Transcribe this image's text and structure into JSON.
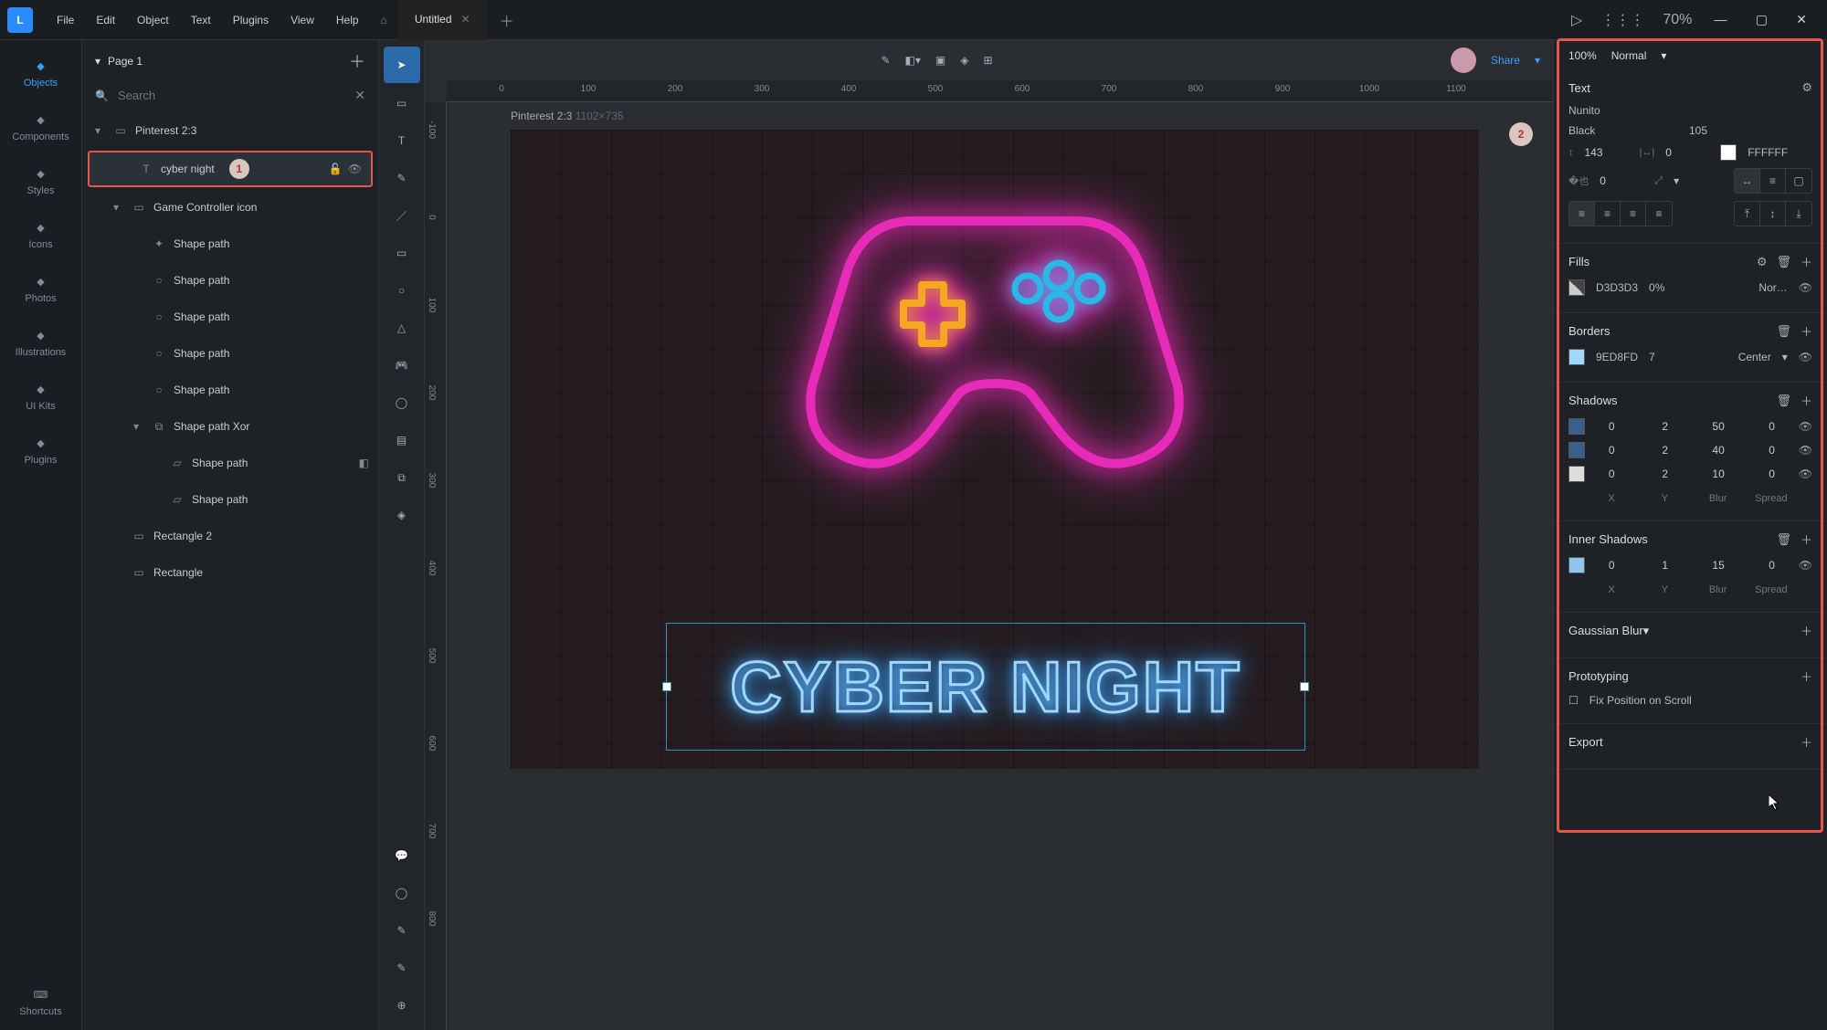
{
  "menu": [
    "File",
    "Edit",
    "Object",
    "Text",
    "Plugins",
    "View",
    "Help"
  ],
  "tab": {
    "title": "Untitled"
  },
  "zoom": "70%",
  "share": "Share",
  "opacity": "100%",
  "blend": "Normal",
  "rail": [
    {
      "l": "Objects",
      "a": true
    },
    {
      "l": "Components"
    },
    {
      "l": "Styles"
    },
    {
      "l": "Icons"
    },
    {
      "l": "Photos"
    },
    {
      "l": "Illustrations"
    },
    {
      "l": "UI Kits"
    },
    {
      "l": "Plugins"
    }
  ],
  "railEnd": {
    "l": "Shortcuts"
  },
  "page": "Page 1",
  "searchPh": "Search",
  "tree": [
    {
      "lv": 1,
      "ch": "▾",
      "ic": "▭",
      "t": "Pinterest 2:3"
    },
    {
      "lv": 2,
      "sel": true,
      "ic": "T",
      "t": "cyber night",
      "badge": "1",
      "lock": true,
      "eye": true
    },
    {
      "lv": 2,
      "ch": "▾",
      "ic": "▭",
      "t": "Game Controller icon"
    },
    {
      "lv": 3,
      "ic": "✦",
      "t": "Shape path"
    },
    {
      "lv": 3,
      "ic": "○",
      "t": "Shape path"
    },
    {
      "lv": 3,
      "ic": "○",
      "t": "Shape path"
    },
    {
      "lv": 3,
      "ic": "○",
      "t": "Shape path"
    },
    {
      "lv": 3,
      "ic": "○",
      "t": "Shape path"
    },
    {
      "lv": 3,
      "ch": "▾",
      "ic": "⧉",
      "t": "Shape path Xor"
    },
    {
      "lv": 4,
      "ic": "▱",
      "t": "Shape path",
      "end": "◧"
    },
    {
      "lv": 4,
      "ic": "▱",
      "t": "Shape path"
    },
    {
      "lv": 2,
      "ic": "▭",
      "t": "Rectangle 2"
    },
    {
      "lv": 2,
      "ic": "▭",
      "t": "Rectangle"
    }
  ],
  "tools": [
    "▭",
    "T",
    "✎",
    "／",
    "▭",
    "○",
    "△",
    "🎮",
    "◯",
    "▤",
    "⧉",
    "◈"
  ],
  "toolsEnd": [
    "💬",
    "◯",
    "✎",
    "✎",
    "⊕"
  ],
  "rulerH": [
    {
      "p": 60,
      "v": "0"
    },
    {
      "p": 155,
      "v": "100"
    },
    {
      "p": 250,
      "v": "200"
    },
    {
      "p": 345,
      "v": "300"
    },
    {
      "p": 440,
      "v": "400"
    },
    {
      "p": 535,
      "v": "500"
    },
    {
      "p": 630,
      "v": "600"
    },
    {
      "p": 725,
      "v": "700"
    },
    {
      "p": 820,
      "v": "800"
    },
    {
      "p": 915,
      "v": "900"
    },
    {
      "p": 1010,
      "v": "1000"
    },
    {
      "p": 1105,
      "v": "1100"
    }
  ],
  "rulerV": [
    {
      "p": 30,
      "v": "-100"
    },
    {
      "p": 126,
      "v": "0"
    },
    {
      "p": 222,
      "v": "100"
    },
    {
      "p": 318,
      "v": "200"
    },
    {
      "p": 414,
      "v": "300"
    },
    {
      "p": 510,
      "v": "400"
    },
    {
      "p": 606,
      "v": "500"
    },
    {
      "p": 702,
      "v": "600"
    },
    {
      "p": 798,
      "v": "700"
    },
    {
      "p": 894,
      "v": "800"
    }
  ],
  "artLabel": "Pinterest 2:3",
  "artDim": "1102×735",
  "neon": "CYBER NIGHT",
  "text": {
    "hdr": "Text",
    "font": "Nunito",
    "weight": "Black",
    "size": "105",
    "lh": "143",
    "ls": "0",
    "color": "FFFFFF",
    "para": "0"
  },
  "fills": {
    "hdr": "Fills",
    "hex": "D3D3D3",
    "op": "0%",
    "mode": "Nor…"
  },
  "borders": {
    "hdr": "Borders",
    "hex": "9ED8FD",
    "w": "7",
    "pos": "Center"
  },
  "shadows": {
    "hdr": "Shadows",
    "rows": [
      {
        "c": "#3a5f8f",
        "x": "0",
        "y": "2",
        "b": "50",
        "s": "0"
      },
      {
        "c": "#3a5f8f",
        "x": "0",
        "y": "2",
        "b": "40",
        "s": "0"
      },
      {
        "c": "#ddd",
        "x": "0",
        "y": "2",
        "b": "10",
        "s": "0"
      }
    ],
    "lbls": [
      "X",
      "Y",
      "Blur",
      "Spread"
    ]
  },
  "inshadows": {
    "hdr": "Inner Shadows",
    "rows": [
      {
        "c": "#8fc4ef",
        "x": "0",
        "y": "1",
        "b": "15",
        "s": "0"
      }
    ],
    "lbls": [
      "X",
      "Y",
      "Blur",
      "Spread"
    ]
  },
  "gauss": "Gaussian Blur",
  "proto": "Prototyping",
  "fixpos": "Fix Position on Scroll",
  "export": "Export"
}
